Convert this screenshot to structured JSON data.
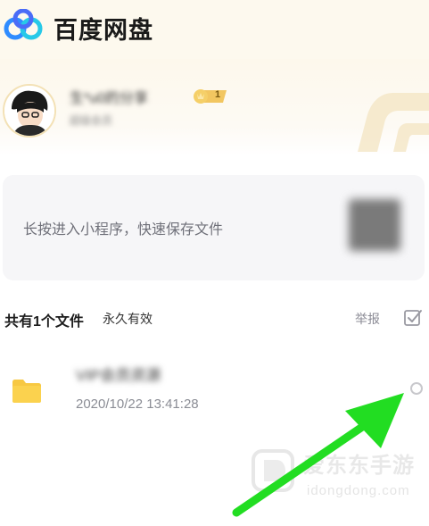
{
  "header": {
    "app_title": "百度网盘",
    "logo_icon": "baidu-netdisk-logo"
  },
  "profile": {
    "username": "生*u0的分享",
    "subtitle": "超级会员",
    "level": "1"
  },
  "mini_program": {
    "text": "长按进入小程序，快速保存文件"
  },
  "files_header": {
    "count_label": "共有1个文件",
    "validity_label": "永久有效",
    "report_label": "举报",
    "select_all_icon": "checkbox-icon"
  },
  "files": [
    {
      "name": "VIP会员资源",
      "date": "2020/10/22 13:41:28",
      "icon": "folder-icon"
    }
  ],
  "watermark": {
    "title": "爱东东手游",
    "url": "idongdong.com"
  },
  "colors": {
    "header_bg": "#fdf9ee",
    "folder": "#f7c842",
    "arrow": "#22dd22",
    "muted_text": "#8b8d95"
  }
}
